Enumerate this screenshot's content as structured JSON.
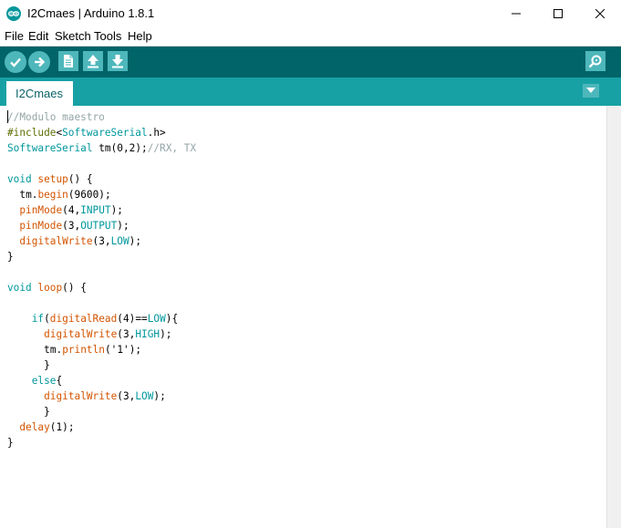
{
  "window": {
    "title": "I2Cmaes | Arduino 1.8.1"
  },
  "menu": {
    "items": [
      "File",
      "Edit",
      "Sketch",
      "Tools",
      "Help"
    ]
  },
  "toolbar": {
    "buttons": [
      "verify-icon",
      "upload-icon",
      "new-icon",
      "open-icon",
      "save-icon"
    ],
    "serial_monitor": "serial-monitor-icon"
  },
  "tabs": {
    "active": "I2Cmaes"
  },
  "editor": {
    "lines": [
      "//Modulo maestro",
      "#include<SoftwareSerial.h>",
      "SoftwareSerial tm(0,2);//RX, TX",
      "",
      "void setup() {",
      "  tm.begin(9600);",
      "  pinMode(4,INPUT);",
      "  pinMode(3,OUTPUT);",
      "  digitalWrite(3,LOW);",
      "}",
      "",
      "void loop() {",
      "",
      "    if(digitalRead(4)==LOW){",
      "      digitalWrite(3,HIGH);",
      "      tm.println('1');",
      "      }",
      "    else{",
      "      digitalWrite(3,LOW);",
      "      }",
      "  delay(1);",
      "}"
    ]
  },
  "colors": {
    "toolbar": "#006468",
    "tabstrip": "#17a1a5",
    "button": "#4db7bb",
    "keyword_type": "#00979c",
    "function": "#d35400",
    "comment": "#95a5a6",
    "directive": "#5e6d03"
  }
}
